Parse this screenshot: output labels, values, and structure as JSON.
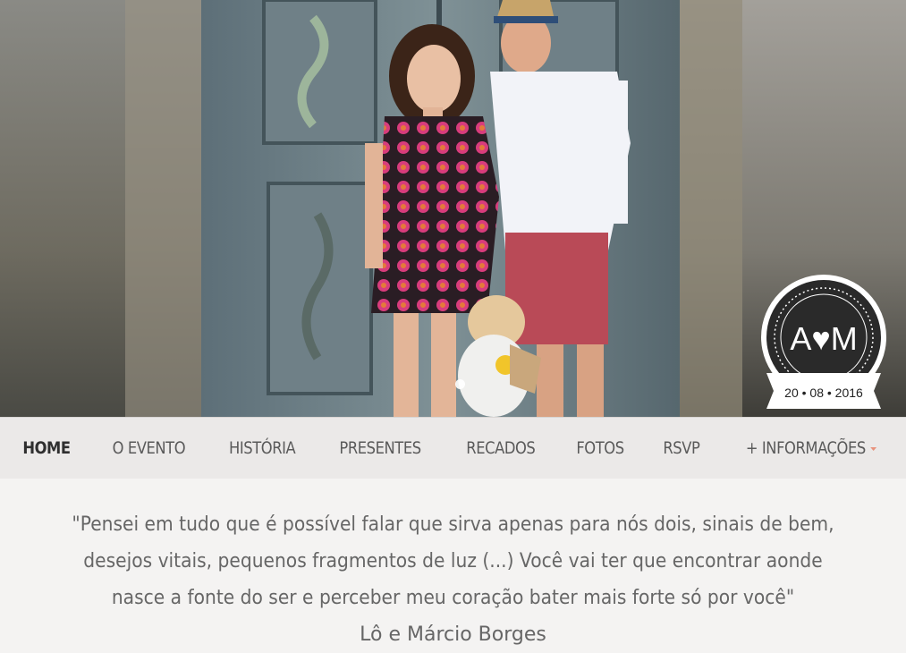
{
  "hero": {
    "monogram_initials": "A•M",
    "monogram_date": "20 • 08 • 2016",
    "carousel_active_index": 0
  },
  "nav": {
    "items": [
      {
        "label": "HOME",
        "active": true
      },
      {
        "label": "O EVENTO"
      },
      {
        "label": "HISTÓRIA"
      },
      {
        "label": "PRESENTES"
      },
      {
        "label": "RECADOS"
      },
      {
        "label": "FOTOS"
      },
      {
        "label": "RSVP"
      },
      {
        "label": "+ INFORMAÇÕES",
        "dropdown": true
      }
    ]
  },
  "quote": {
    "text": "\"Pensei em tudo que é possível falar que sirva apenas para nós dois, sinais de bem, desejos vitais, pequenos fragmentos de luz (...) Você vai ter que encontrar aonde nasce a fonte do ser e perceber meu coração bater mais forte só por você\"",
    "author": "Lô e Márcio Borges"
  },
  "colors": {
    "nav_bg": "#ebe9e8",
    "page_bg": "#f4f3f2",
    "caret": "#e8927c",
    "text": "#666666"
  }
}
